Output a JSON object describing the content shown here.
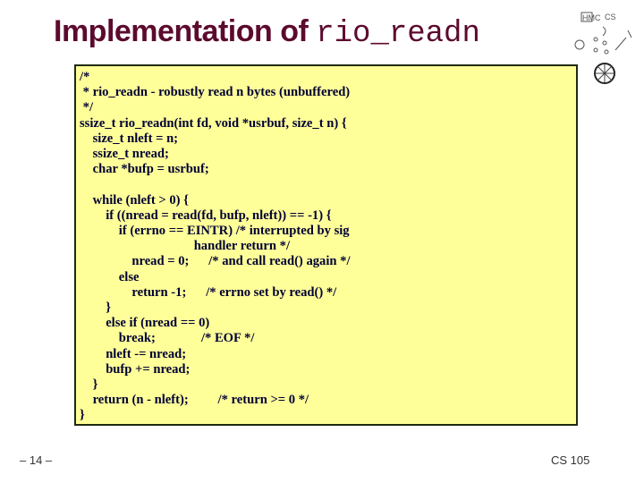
{
  "slide": {
    "title_prefix": "Implementation of ",
    "title_code": "rio_readn",
    "logo": "hmc-cs-logo-icon",
    "code_lines": [
      "/*",
      " * rio_readn - robustly read n bytes (unbuffered)",
      " */",
      "ssize_t rio_readn(int fd, void *usrbuf, size_t n) {",
      "    size_t nleft = n;",
      "    ssize_t nread;",
      "    char *bufp = usrbuf;",
      "",
      "    while (nleft > 0) {",
      "        if ((nread = read(fd, bufp, nleft)) == -1) {",
      "            if (errno == EINTR) /* interrupted by sig",
      "                                   handler return */",
      "                nread = 0;      /* and call read() again */",
      "            else",
      "                return -1;      /* errno set by read() */",
      "        }",
      "        else if (nread == 0)",
      "            break;              /* EOF */",
      "        nleft -= nread;",
      "        bufp += nread;",
      "    }",
      "    return (n - nleft);         /* return >= 0 */",
      "}"
    ],
    "page_number": "– 14 –",
    "course": "CS 105"
  }
}
